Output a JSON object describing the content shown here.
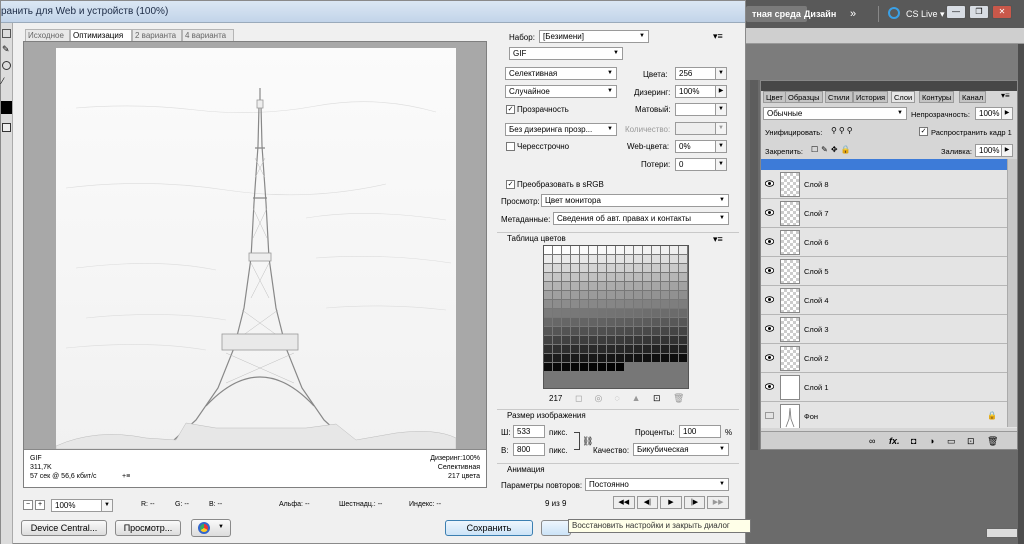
{
  "dialog": {
    "title": "ранить для Web и устройств (100%)",
    "tabs": [
      "Исходное",
      "Оптимизация",
      "2 варианта",
      "4 варианта"
    ],
    "active_tab": 1
  },
  "header": {
    "workspace": "тная среда",
    "design": "Дизайн",
    "more": "»",
    "cslive": "CS Live",
    "cslive_arrow": "▾"
  },
  "image_info": {
    "format": "GIF",
    "size": "311,7K",
    "time": "57 сек @ 56,6 кбит/с",
    "time_menu": "+≡",
    "dither": "Дизеринг:100%",
    "palette": "Селективная",
    "colors": "217 цвета"
  },
  "bottom": {
    "zoom": "100%",
    "zoom_minus": "−",
    "zoom_plus": "+",
    "r": "R: --",
    "g": "G: --",
    "b": "B: --",
    "alpha": "Альфа: --",
    "hex": "Шестнадц.: --",
    "index": "Индекс: --"
  },
  "buttons": {
    "device_central": "Device Central...",
    "preview": "Просмотр...",
    "save": "Сохранить",
    "tooltip": "Восстановить настройки и закрыть диалог"
  },
  "settings": {
    "preset_label": "Набор:",
    "preset_value": "[Безимени]",
    "format": "GIF",
    "reduction": "Селективная",
    "colors_label": "Цвета:",
    "colors_value": "256",
    "dither_algo": "Случайное",
    "dither_label": "Дизеринг:",
    "dither_value": "100%",
    "transparency": "Прозрачность",
    "transparency_checked": true,
    "matte_label": "Матовый:",
    "matte_value": "",
    "transp_dither": "Без дизеринга прозр...",
    "amount_label": "Количество:",
    "amount_value": "",
    "interlaced": "Чересстрочно",
    "interlaced_checked": false,
    "web_label": "Web-цвета:",
    "web_value": "0%",
    "loss_label": "Потери:",
    "loss_value": "0",
    "srgb": "Преобразовать в sRGB",
    "srgb_checked": true,
    "preview_label": "Просмотр:",
    "preview_value": "Цвет монитора",
    "meta_label": "Метаданные:",
    "meta_value": "Сведения об авт. правах и контакты"
  },
  "color_table": {
    "title": "Таблица цветов",
    "count": "217"
  },
  "image_size": {
    "title": "Размер изображения",
    "w_label": "Ш:",
    "w_value": "533",
    "h_label": "В:",
    "h_value": "800",
    "unit": "пикс.",
    "percent_label": "Проценты:",
    "percent_value": "100",
    "percent_sign": "%",
    "quality_label": "Качество:",
    "quality_value": "Бикубическая"
  },
  "animation": {
    "title": "Анимация",
    "loop_label": "Параметры повторов:",
    "loop_value": "Постоянно",
    "frame": "9 из 9"
  },
  "layers_panel": {
    "tabs": [
      "Цвет",
      "Образцы",
      "Стили",
      "История",
      "Слои",
      "Контуры",
      "Канал"
    ],
    "active_tab": 4,
    "blend_mode": "Обычные",
    "opacity_label": "Непрозрачность:",
    "opacity_value": "100%",
    "unify_label": "Унифицировать:",
    "propagate_label": "Распространить кадр 1",
    "lock_label": "Закрепить:",
    "fill_label": "Заливка:",
    "fill_value": "100%",
    "layers": [
      "Слой 8",
      "Слой 7",
      "Слой 6",
      "Слой 5",
      "Слой 4",
      "Слой 3",
      "Слой 2",
      "Слой 1",
      "Фон"
    ],
    "bottom_icons": [
      "link-icon",
      "fx-icon",
      "mask-icon",
      "adjustment-icon",
      "folder-icon",
      "new-layer-icon",
      "trash-icon"
    ]
  }
}
